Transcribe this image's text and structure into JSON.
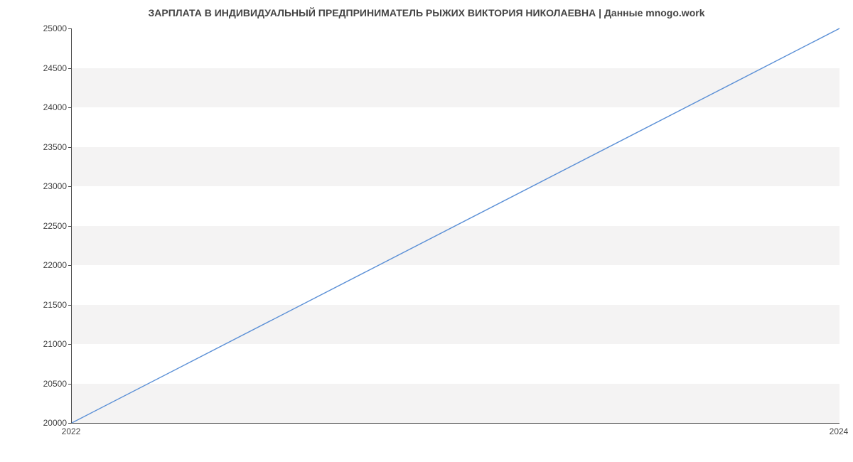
{
  "chart_data": {
    "type": "line",
    "title": "ЗАРПЛАТА В ИНДИВИДУАЛЬНЫЙ ПРЕДПРИНИМАТЕЛЬ РЫЖИХ ВИКТОРИЯ НИКОЛАЕВНА | Данные mnogo.work",
    "xlabel": "",
    "ylabel": "",
    "x": [
      2022,
      2024
    ],
    "values": [
      20000,
      25000
    ],
    "xlim": [
      2022,
      2024
    ],
    "ylim": [
      20000,
      25000
    ],
    "y_ticks": [
      20000,
      20500,
      21000,
      21500,
      22000,
      22500,
      23000,
      23500,
      24000,
      24500,
      25000
    ],
    "x_ticks": [
      2022,
      2024
    ],
    "line_color": "#5a8fd6",
    "band_color": "#f4f3f3"
  }
}
